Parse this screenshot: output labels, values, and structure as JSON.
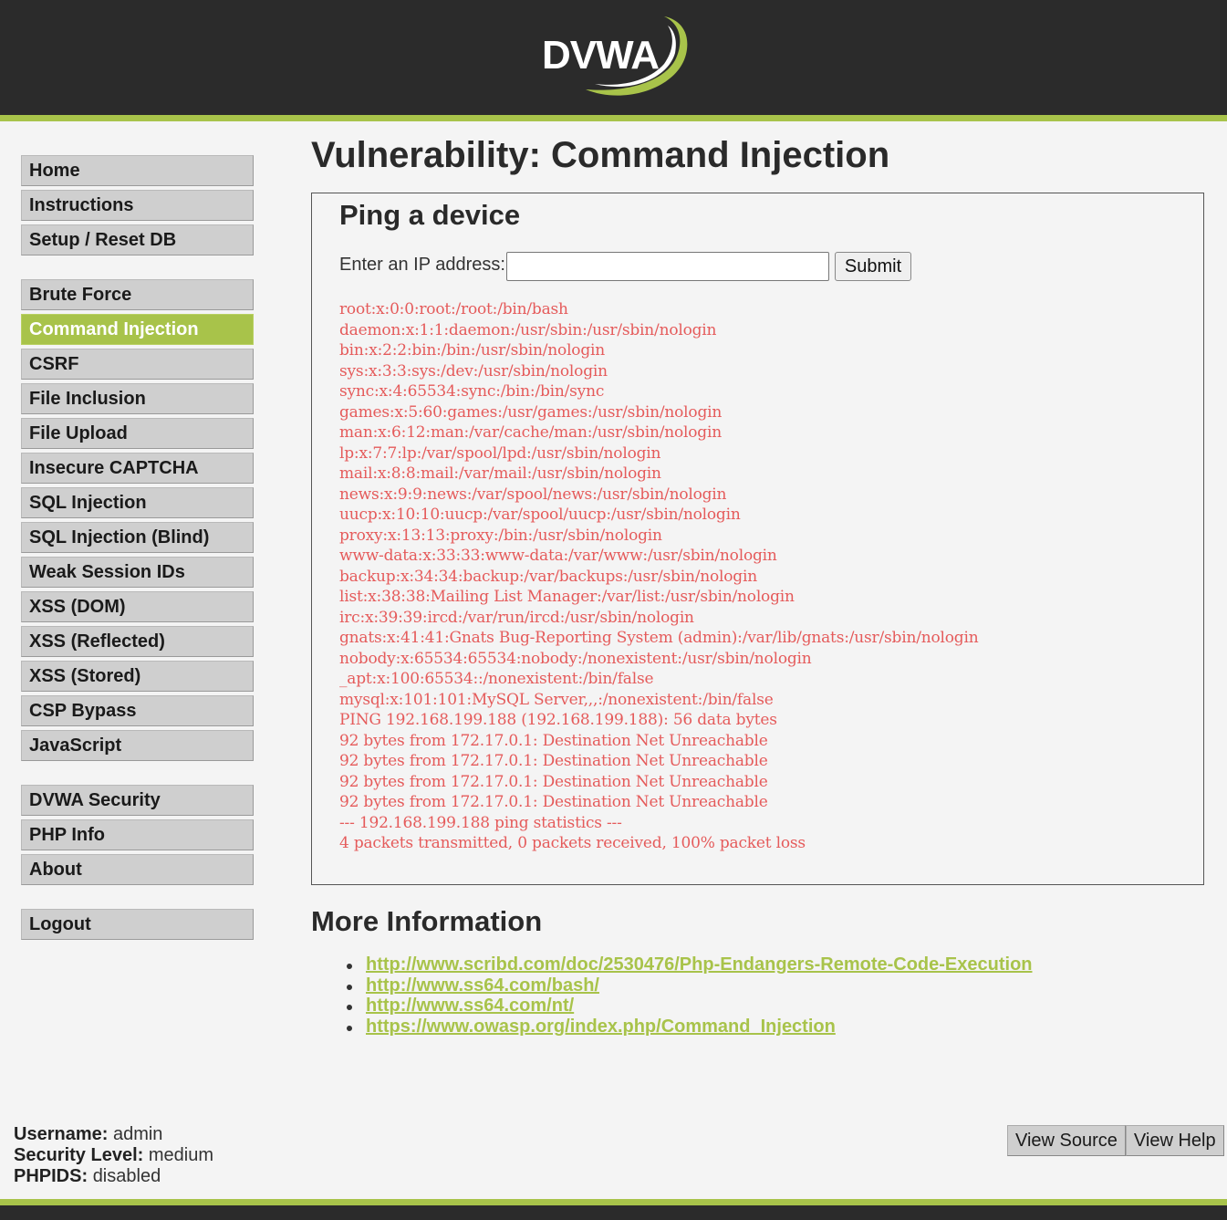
{
  "logo": {
    "text": "DVWA"
  },
  "sidebar": {
    "groups": [
      [
        "Home",
        "Instructions",
        "Setup / Reset DB"
      ],
      [
        "Brute Force",
        "Command Injection",
        "CSRF",
        "File Inclusion",
        "File Upload",
        "Insecure CAPTCHA",
        "SQL Injection",
        "SQL Injection (Blind)",
        "Weak Session IDs",
        "XSS (DOM)",
        "XSS (Reflected)",
        "XSS (Stored)",
        "CSP Bypass",
        "JavaScript"
      ],
      [
        "DVWA Security",
        "PHP Info",
        "About"
      ],
      [
        "Logout"
      ]
    ],
    "active": "Command Injection"
  },
  "main": {
    "title": "Vulnerability: Command Injection",
    "box_title": "Ping a device",
    "ip_label": "Enter an IP address:",
    "ip_value": "",
    "submit_label": "Submit",
    "output": [
      "root:x:0:0:root:/root:/bin/bash",
      "daemon:x:1:1:daemon:/usr/sbin:/usr/sbin/nologin",
      "bin:x:2:2:bin:/bin:/usr/sbin/nologin",
      "sys:x:3:3:sys:/dev:/usr/sbin/nologin",
      "sync:x:4:65534:sync:/bin:/bin/sync",
      "games:x:5:60:games:/usr/games:/usr/sbin/nologin",
      "man:x:6:12:man:/var/cache/man:/usr/sbin/nologin",
      "lp:x:7:7:lp:/var/spool/lpd:/usr/sbin/nologin",
      "mail:x:8:8:mail:/var/mail:/usr/sbin/nologin",
      "news:x:9:9:news:/var/spool/news:/usr/sbin/nologin",
      "uucp:x:10:10:uucp:/var/spool/uucp:/usr/sbin/nologin",
      "proxy:x:13:13:proxy:/bin:/usr/sbin/nologin",
      "www-data:x:33:33:www-data:/var/www:/usr/sbin/nologin",
      "backup:x:34:34:backup:/var/backups:/usr/sbin/nologin",
      "list:x:38:38:Mailing List Manager:/var/list:/usr/sbin/nologin",
      "irc:x:39:39:ircd:/var/run/ircd:/usr/sbin/nologin",
      "gnats:x:41:41:Gnats Bug-Reporting System (admin):/var/lib/gnats:/usr/sbin/nologin",
      "nobody:x:65534:65534:nobody:/nonexistent:/usr/sbin/nologin",
      "_apt:x:100:65534::/nonexistent:/bin/false",
      "mysql:x:101:101:MySQL Server,,,:/nonexistent:/bin/false",
      "PING 192.168.199.188 (192.168.199.188): 56 data bytes",
      "92 bytes from 172.17.0.1: Destination Net Unreachable",
      "92 bytes from 172.17.0.1: Destination Net Unreachable",
      "92 bytes from 172.17.0.1: Destination Net Unreachable",
      "92 bytes from 172.17.0.1: Destination Net Unreachable",
      "--- 192.168.199.188 ping statistics ---",
      "4 packets transmitted, 0 packets received, 100% packet loss"
    ],
    "more_title": "More Information",
    "links": [
      "http://www.scribd.com/doc/2530476/Php-Endangers-Remote-Code-Execution",
      "http://www.ss64.com/bash/",
      "http://www.ss64.com/nt/",
      "https://www.owasp.org/index.php/Command_Injection"
    ]
  },
  "status": {
    "username_label": "Username:",
    "username": "admin",
    "security_label": "Security Level:",
    "security": "medium",
    "phpids_label": "PHPIDS:",
    "phpids": "disabled"
  },
  "footer": {
    "view_source": "View Source",
    "view_help": "View Help"
  },
  "colors": {
    "accent": "#a8c34a",
    "header_bg": "#2b2b2b",
    "output_text": "#e55b5b"
  }
}
